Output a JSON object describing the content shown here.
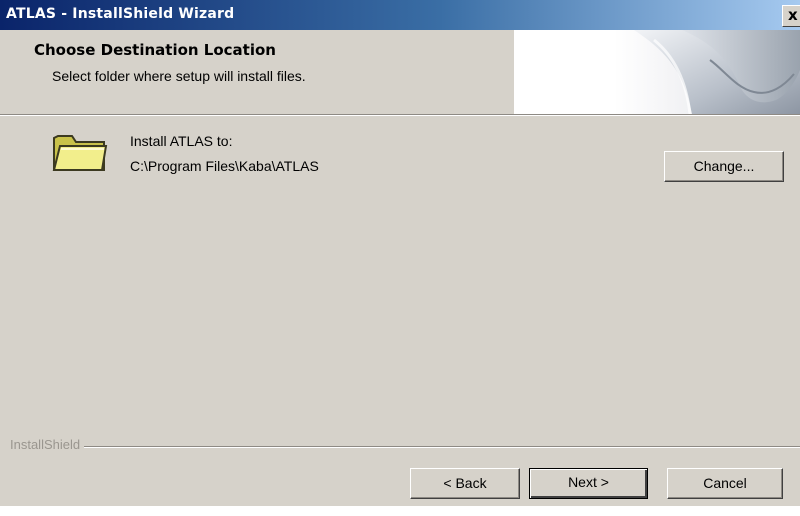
{
  "window": {
    "title": "ATLAS - InstallShield Wizard",
    "close_glyph": "x"
  },
  "header": {
    "title": "Choose Destination Location",
    "subtitle": "Select folder where setup will install files."
  },
  "destination": {
    "icon": "folder-icon",
    "label": "Install ATLAS to:",
    "path": "C:\\Program Files\\Kaba\\ATLAS",
    "change_label": "Change..."
  },
  "footer": {
    "brand": "InstallShield",
    "back_label": "< Back",
    "next_label": "Next >",
    "cancel_label": "Cancel"
  },
  "colors": {
    "dialog_face": "#d6d2ca",
    "titlebar_start": "#0a246a",
    "titlebar_end": "#a6caf0",
    "folder_yellow": "#f2ee8c"
  }
}
